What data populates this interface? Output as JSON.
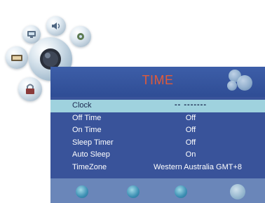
{
  "menu": {
    "title": "TIME",
    "rows": [
      {
        "label": "Clock",
        "value": "-- -------"
      },
      {
        "label": "Off Time",
        "value": "Off"
      },
      {
        "label": "On Time",
        "value": "Off"
      },
      {
        "label": "Sleep Timer",
        "value": "Off"
      },
      {
        "label": "Auto Sleep",
        "value": "On"
      },
      {
        "label": "TimeZone",
        "value": "Western Australia GMT+8"
      }
    ],
    "selected_index": 0
  },
  "icons": {
    "menu_bubbles": [
      "picture-icon",
      "sound-icon",
      "setup-icon",
      "channel-icon",
      "time-icon",
      "lock-icon"
    ],
    "title_decoration": "bubbles-icon",
    "bottom_nav": [
      "nav-button-1",
      "nav-button-2",
      "nav-button-3",
      "nav-button-4"
    ]
  },
  "colors": {
    "panel_bg": "#39539a",
    "title_text": "#e05a3a",
    "selected_row": "#9fd2de",
    "bottom_bar": "#6a86b9"
  }
}
